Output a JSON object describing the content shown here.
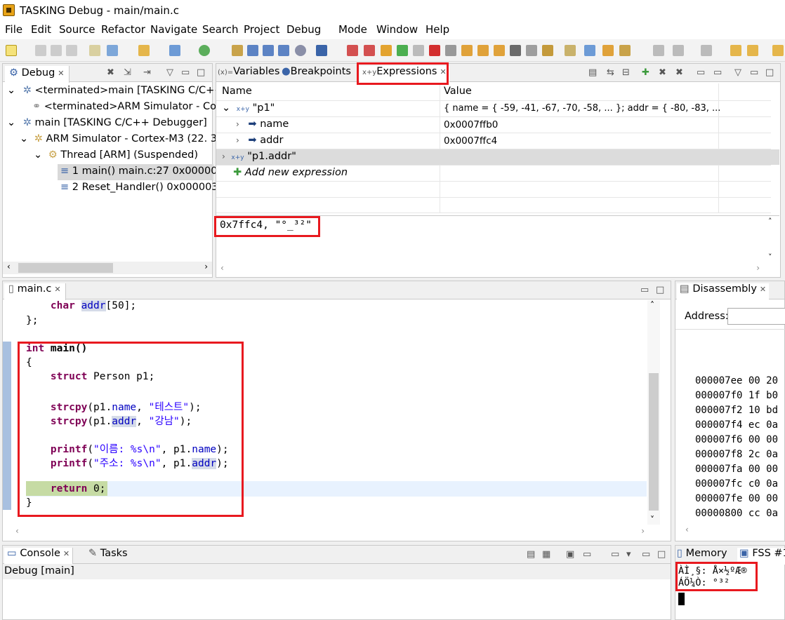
{
  "window": {
    "title": "TASKING Debug - main/main.c"
  },
  "menu": [
    "File",
    "Edit",
    "Source",
    "Refactor",
    "Navigate",
    "Search",
    "Project",
    "Debug",
    "Mode",
    "Window",
    "Help"
  ],
  "debug_view": {
    "tab": "Debug",
    "rows": [
      "<terminated>main [TASKING C/C++",
      "<terminated>ARM Simulator - Co",
      "main [TASKING C/C++ Debugger]",
      "ARM Simulator - Cortex-M3 (22. 3",
      "Thread [ARM] (Suspended)",
      "1 main() main.c:27 0x000003",
      "2 Reset_Handler()  0x000003"
    ]
  },
  "expressions_view": {
    "tabs": [
      "Variables",
      "Breakpoints",
      "Expressions"
    ],
    "columns": [
      "Name",
      "Value"
    ],
    "rows": [
      {
        "name": "\"p1\"",
        "value": "{ name = { -59, -41, -67, -70, -58, ... }; addr = { -80, -83, ..."
      },
      {
        "name": "name",
        "value": "0x0007ffb0"
      },
      {
        "name": "addr",
        "value": "0x0007ffc4"
      },
      {
        "name": "\"p1.addr\"",
        "value": ""
      }
    ],
    "add_new": "Add new expression",
    "detail": "0x7ffc4, \"°_³²\""
  },
  "editor": {
    "tab": "main.c",
    "lines": {
      "l1_kw": "char",
      "l1_id": "addr",
      "l1_rest": "[50];",
      "l2": "};",
      "l3_kw": "int",
      "l3_rest": " main()",
      "l4": "{",
      "l5_kw": "struct",
      "l5_rest": " Person p1;",
      "l6_fn": "strcpy",
      "l6_a": "(p1.",
      "l6_f": "name",
      "l6_b": ", ",
      "l6_s": "\"테스트\"",
      "l6_c": ");",
      "l7_fn": "strcpy",
      "l7_a": "(p1.",
      "l7_f": "addr",
      "l7_b": ", ",
      "l7_s": "\"강남\"",
      "l7_c": ");",
      "l8_fn": "printf",
      "l8_a": "(",
      "l8_s": "\"이름: %s\\n\"",
      "l8_b": ", p1.",
      "l8_f": "name",
      "l8_c": ");",
      "l9_fn": "printf",
      "l9_a": "(",
      "l9_s": "\"주소: %s\\n\"",
      "l9_b": ", p1.",
      "l9_f": "addr",
      "l9_c": ");",
      "l10_kw": "return",
      "l10_rest": " 0;",
      "l11": "}"
    }
  },
  "disassembly": {
    "tab": "Disassembly",
    "address_label": "Address:",
    "lines": [
      "000007ee 00 20",
      "000007f0 1f b0",
      "000007f2 10 bd",
      "000007f4 ec 0a",
      "000007f6 00 00",
      "000007f8 2c 0a",
      "000007fa 00 00",
      "000007fc c0 0a",
      "000007fe 00 00",
      "00000800 cc 0a"
    ]
  },
  "console": {
    "tabs": [
      "Console",
      "Tasks"
    ],
    "title": "Debug [main]"
  },
  "memory": {
    "tabs": [
      "Memory",
      "FSS #1"
    ],
    "line1": "ÀÌ¸§: Å×½ºÆ®",
    "line2": "ÁÖ¼Ò: °­³²"
  }
}
